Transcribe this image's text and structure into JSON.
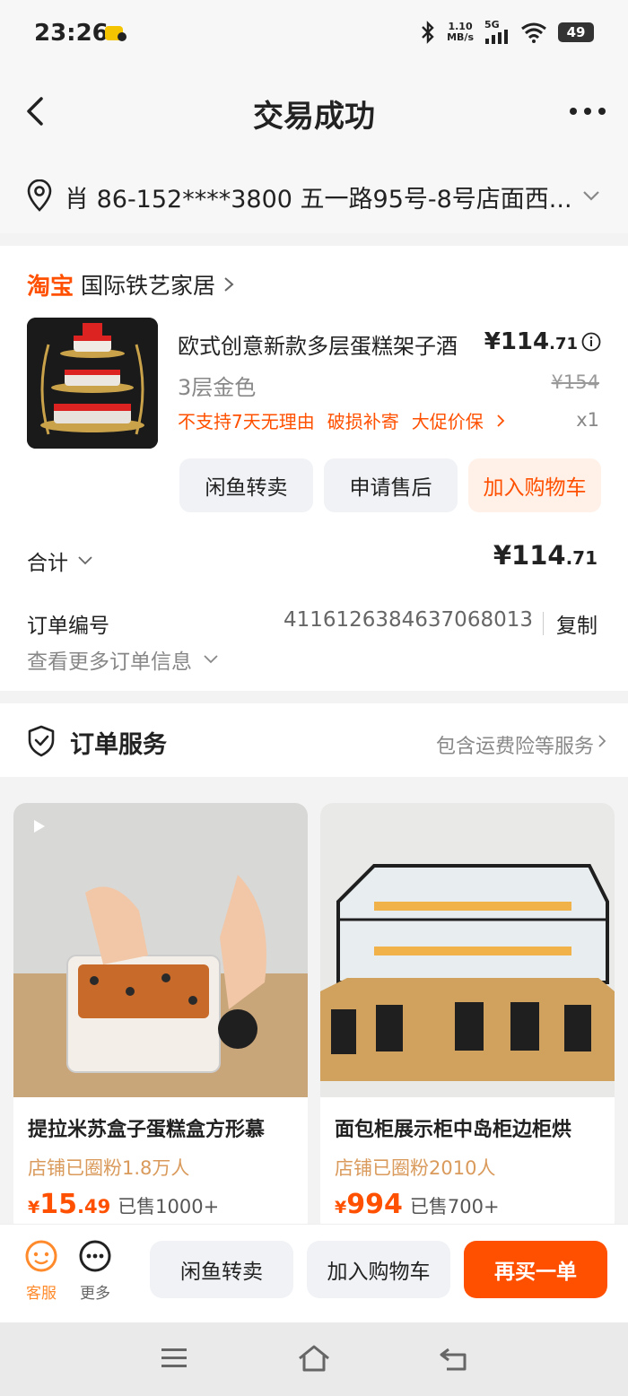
{
  "status_bar": {
    "time": "23:26",
    "net_speed_value": "1.10",
    "net_speed_unit": "MB/s",
    "network": "5G",
    "battery": "49"
  },
  "nav": {
    "title": "交易成功"
  },
  "address": {
    "text": "肖  86-152****3800  五一路95号-8号店面西..."
  },
  "order": {
    "platform": "淘宝",
    "shop_name": "国际铁艺家居",
    "product": {
      "title": "欧式创意新款多层蛋糕架子酒",
      "price_int": "¥114",
      "price_dec": ".71",
      "variant": "3层金色",
      "original_price": "¥154",
      "tags": [
        "不支持7天无理由",
        "破损补寄",
        "大促价保"
      ],
      "quantity": "x1"
    },
    "buttons": {
      "resell": "闲鱼转卖",
      "after_sale": "申请售后",
      "add_cart": "加入购物车"
    },
    "total_label": "合计",
    "total_int": "¥114",
    "total_dec": ".71",
    "order_no_label": "订单编号",
    "order_no": "4116126384637068013",
    "copy_label": "复制",
    "more_info_label": "查看更多订单信息"
  },
  "service": {
    "title": "订单服务",
    "desc": "包含运费险等服务"
  },
  "recommendations": [
    {
      "title": "提拉米苏盒子蛋糕盒方形慕",
      "followers": "店铺已圈粉1.8万人",
      "price_symbol": "¥",
      "price_int": "15",
      "price_dec": ".49",
      "sold": "已售1000+"
    },
    {
      "title": "面包柜展示柜中岛柜边柜烘",
      "followers": "店铺已圈粉2010人",
      "price_symbol": "¥",
      "price_int": "994",
      "price_dec": "",
      "sold": "已售700+"
    }
  ],
  "action_bar": {
    "customer_service": "客服",
    "more": "更多",
    "resell": "闲鱼转卖",
    "add_cart": "加入购物车",
    "rebuy": "再买一单"
  },
  "colors": {
    "accent": "#ff5000",
    "accent_light": "#fff1e8",
    "followers": "#d99a5b",
    "button_bg": "#f0f2f5"
  },
  "icons": [
    "back-icon",
    "more-icon",
    "location-pin-icon",
    "chevron-right-icon",
    "info-icon",
    "shield-check-icon",
    "customer-service-icon",
    "more-circle-icon",
    "video-play-icon",
    "menu-icon",
    "home-icon",
    "back-nav-icon"
  ]
}
